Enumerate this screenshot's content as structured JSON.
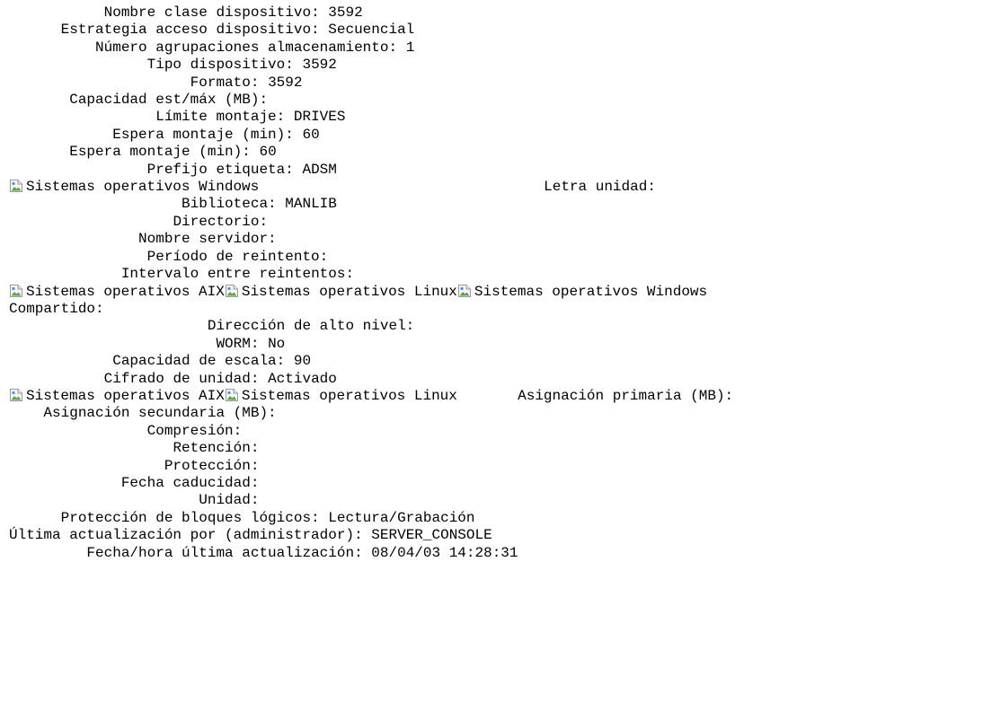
{
  "lines": [
    {
      "fields": [
        {
          "label": "Nombre clase dispositivo:",
          "value": "3592"
        }
      ]
    },
    {
      "fields": [
        {
          "label": "Estrategia acceso dispositivo:",
          "value": "Secuencial"
        }
      ]
    },
    {
      "fields": [
        {
          "label": "Número agrupaciones almacenamiento:",
          "value": "1"
        }
      ]
    },
    {
      "fields": [
        {
          "label": "Tipo dispositivo:",
          "value": "3592"
        }
      ]
    },
    {
      "fields": [
        {
          "label": "Formato:",
          "value": "3592"
        }
      ]
    },
    {
      "fields": [
        {
          "label": "Capacidad est/máx (MB):",
          "value": ""
        }
      ]
    },
    {
      "fields": [
        {
          "label": "Límite montaje:",
          "value": "DRIVES"
        }
      ]
    },
    {
      "fields": [
        {
          "label": "Espera montaje (min):",
          "value": "60"
        }
      ]
    },
    {
      "fields": [
        {
          "label": "Espera montaje (min):",
          "value": "60"
        }
      ]
    },
    {
      "fields": [
        {
          "label": "Prefijo etiqueta:",
          "value": "ADSM"
        }
      ]
    },
    {
      "icons": [
        "Sistemas operativos Windows"
      ],
      "fields": [
        {
          "label": "Letra unidad:",
          "value": ""
        }
      ]
    },
    {
      "fields": [
        {
          "label": "Biblioteca:",
          "value": "MANLIB"
        }
      ]
    },
    {
      "fields": [
        {
          "label": "Directorio:",
          "value": ""
        }
      ]
    },
    {
      "fields": [
        {
          "label": "Nombre servidor:",
          "value": ""
        }
      ]
    },
    {
      "fields": [
        {
          "label": "Período de reintento:",
          "value": ""
        }
      ]
    },
    {
      "fields": [
        {
          "label": "Intervalo entre reintentos:",
          "value": ""
        }
      ]
    },
    {
      "icons": [
        "Sistemas operativos AIX",
        "Sistemas operativos Linux",
        "Sistemas operativos Windows"
      ],
      "fields": []
    },
    {
      "fields": [
        {
          "label": "Compartido:",
          "value": ""
        }
      ]
    },
    {
      "fields": [
        {
          "label": "Dirección de alto nivel:",
          "value": ""
        }
      ]
    },
    {
      "fields": [
        {
          "label": "WORM:",
          "value": "No"
        }
      ]
    },
    {
      "fields": [
        {
          "label": "Capacidad de escala:",
          "value": "90"
        }
      ]
    },
    {
      "fields": [
        {
          "label": "Cifrado de unidad:",
          "value": "Activado"
        }
      ]
    },
    {
      "icons": [
        "Sistemas operativos AIX",
        "Sistemas operativos Linux"
      ],
      "fields": [
        {
          "label": "Asignación primaria (MB):",
          "value": ""
        }
      ]
    },
    {
      "fields": [
        {
          "label": "Asignación secundaria (MB):",
          "value": ""
        }
      ]
    },
    {
      "fields": [
        {
          "label": "Compresión:",
          "value": ""
        }
      ]
    },
    {
      "fields": [
        {
          "label": "Retención:",
          "value": ""
        }
      ]
    },
    {
      "fields": [
        {
          "label": "Protección:",
          "value": ""
        }
      ]
    },
    {
      "fields": [
        {
          "label": "Fecha caducidad:",
          "value": ""
        }
      ]
    },
    {
      "fields": [
        {
          "label": "Unidad:",
          "value": ""
        }
      ]
    },
    {
      "fields": [
        {
          "label": "Protección de bloques lógicos:",
          "value": "Lectura/Grabación"
        }
      ]
    },
    {
      "fields": [
        {
          "label": "Última actualización por (administrador):",
          "value": "SERVER_CONSOLE"
        }
      ]
    },
    {
      "fields": [
        {
          "label": "Fecha/hora última actualización:",
          "value": "08/04/03 14:28:31"
        }
      ]
    }
  ],
  "broken_image_icon": "broken-image-icon"
}
